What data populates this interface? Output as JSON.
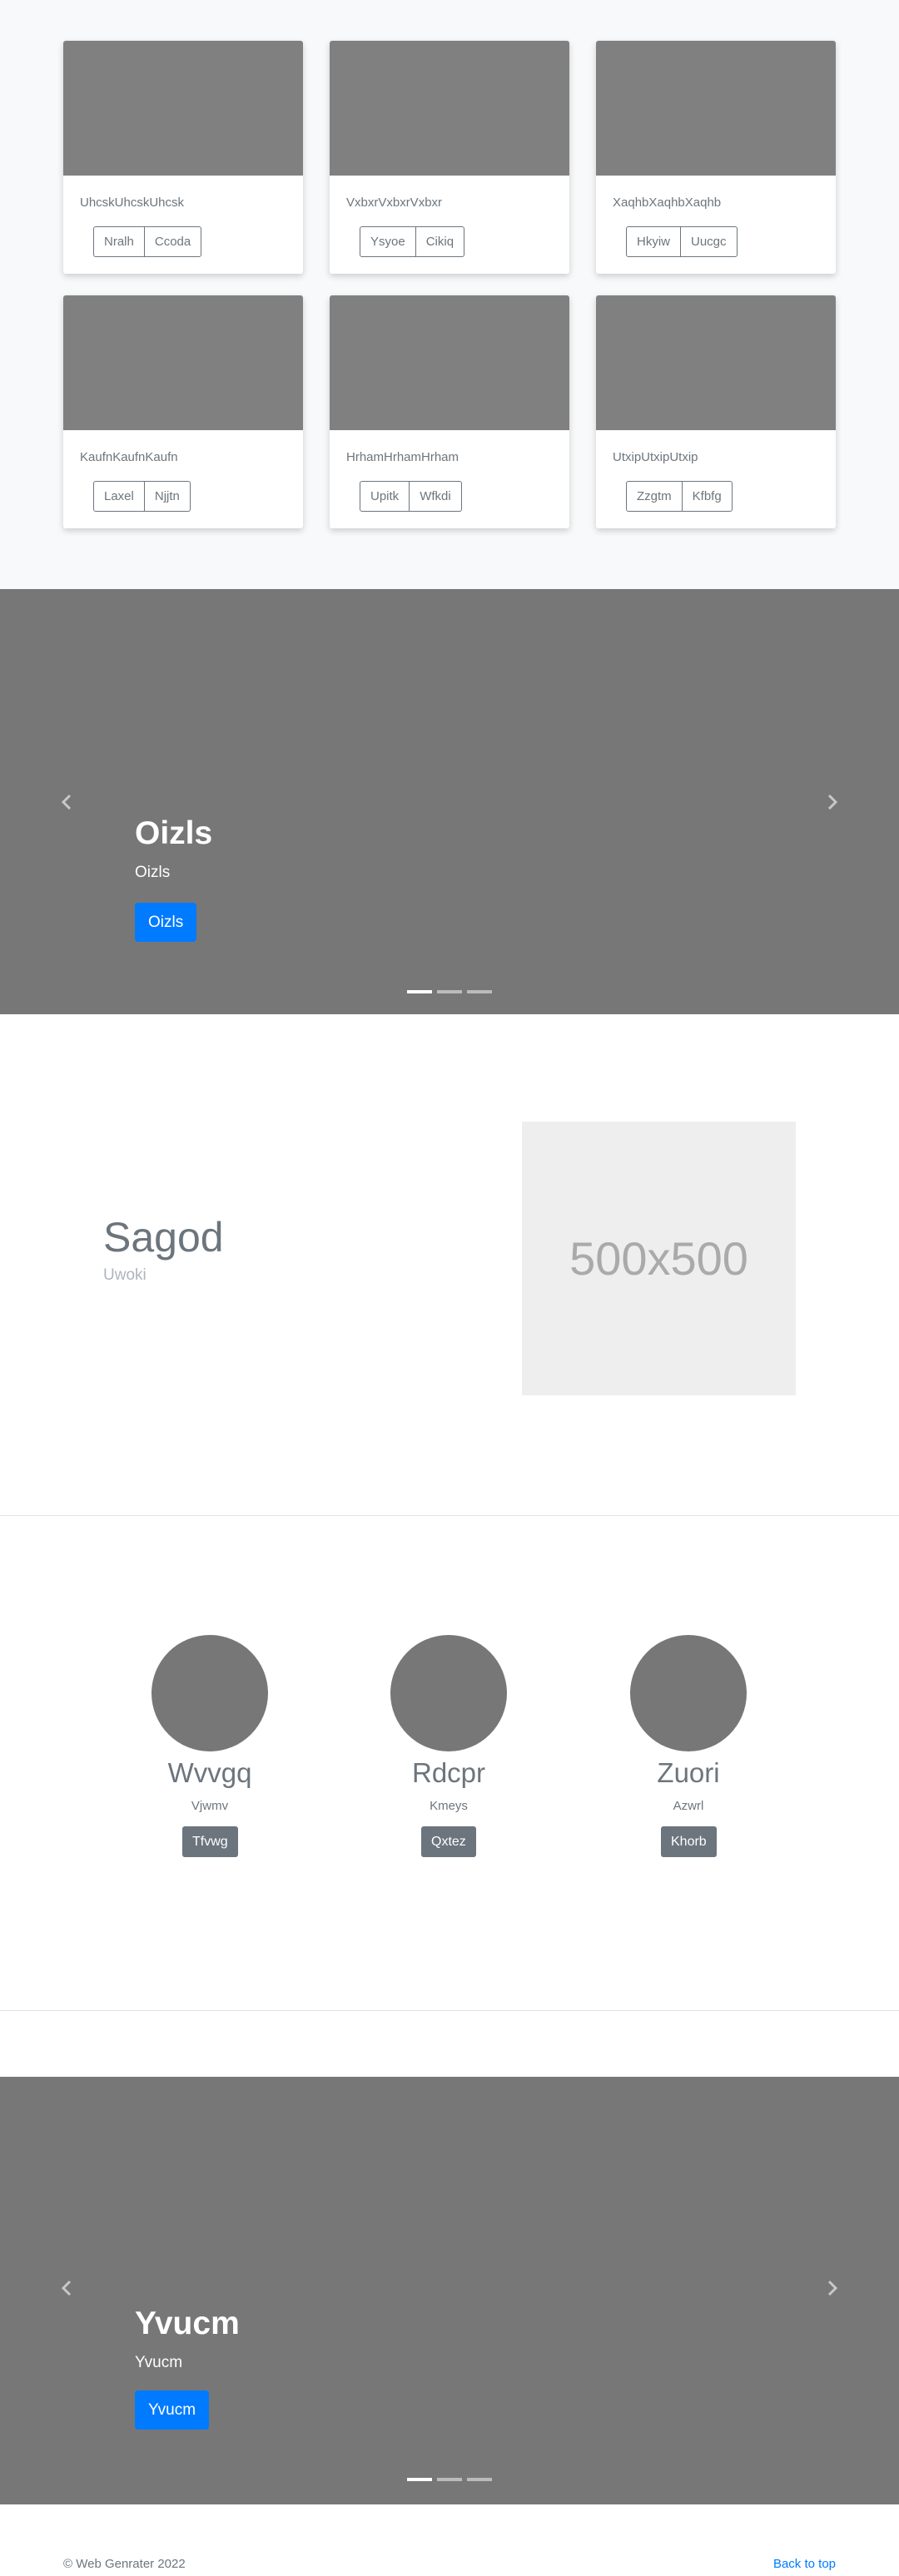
{
  "album": {
    "cards": [
      {
        "title": "UhcskUhcskUhcsk",
        "buttons": [
          "Nralh",
          "Ccoda"
        ]
      },
      {
        "title": "VxbxrVxbxrVxbxr",
        "buttons": [
          "Ysyoe",
          "Cikiq"
        ]
      },
      {
        "title": "XaqhbXaqhbXaqhb",
        "buttons": [
          "Hkyiw",
          "Uucgc"
        ]
      },
      {
        "title": "KaufnKaufnKaufn",
        "buttons": [
          "Laxel",
          "Njjtn"
        ]
      },
      {
        "title": "HrhamHrhamHrham",
        "buttons": [
          "Upitk",
          "Wfkdi"
        ]
      },
      {
        "title": "UtxipUtxipUtxip",
        "buttons": [
          "Zzgtm",
          "Kfbfg"
        ]
      }
    ]
  },
  "carousel1": {
    "title": "Oizls",
    "subtitle": "Oizls",
    "button": "Oizls",
    "slides": 3,
    "active_slide": 1
  },
  "feature": {
    "title": "Sagod",
    "subtitle": "Uwoki",
    "placeholder": "500x500"
  },
  "team": {
    "members": [
      {
        "name": "Wvvgq",
        "role": "Vjwmv",
        "button": "Tfvwg"
      },
      {
        "name": "Rdcpr",
        "role": "Kmeys",
        "button": "Qxtez"
      },
      {
        "name": "Zuori",
        "role": "Azwrl",
        "button": "Khorb"
      }
    ]
  },
  "carousel2": {
    "title": "Yvucm",
    "subtitle": "Yvucm",
    "button": "Yvucm",
    "slides": 3,
    "active_slide": 1
  },
  "footer": {
    "copyright": "© Web Genrater 2022",
    "back_to_top": "Back to top"
  },
  "icons": {
    "prev": "chevron-left-icon",
    "next": "chevron-right-icon"
  },
  "colors": {
    "primary": "#007bff",
    "secondary": "#6c757d",
    "placeholder": "#777777"
  }
}
